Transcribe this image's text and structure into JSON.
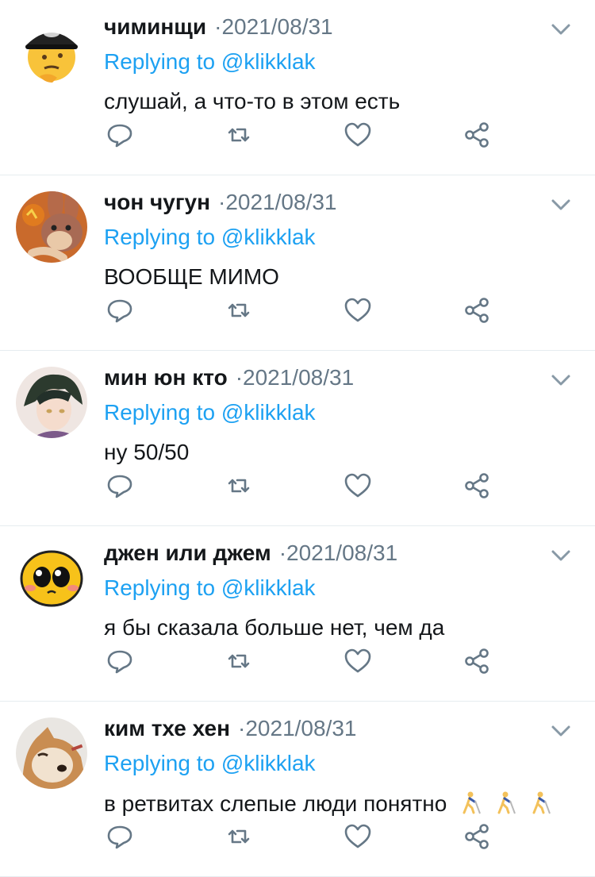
{
  "theme": {
    "text": "#14171a",
    "muted": "#657786",
    "link": "#1da1f2",
    "divider": "#e6ecf0",
    "icon": "#657786"
  },
  "tweets": [
    {
      "name": "чиминщи",
      "sep": "·",
      "date": "2021/08/31",
      "reply_prefix": "Replying to",
      "handle": "@klikklak",
      "text": "слушай, а что-то в этом есть",
      "avatar_icon": "thinking-face-cap-avatar"
    },
    {
      "name": "чон чугун",
      "sep": "·",
      "date": "2021/08/31",
      "reply_prefix": "Replying to",
      "handle": "@klikklak",
      "text": "ВООБЩЕ МИМО",
      "avatar_icon": "bunny-avatar"
    },
    {
      "name": "мин юн кто",
      "sep": "·",
      "date": "2021/08/31",
      "reply_prefix": "Replying to",
      "handle": "@klikklak",
      "text": "ну 50/50",
      "avatar_icon": "anime-character-avatar"
    },
    {
      "name": "джен или джем",
      "sep": "·",
      "date": "2021/08/31",
      "reply_prefix": "Replying to",
      "handle": "@klikklak",
      "text": "я бы сказала больше нет, чем да",
      "avatar_icon": "pleading-face-avatar"
    },
    {
      "name": "ким тхе хен",
      "sep": "·",
      "date": "2021/08/31",
      "reply_prefix": "Replying to",
      "handle": "@klikklak",
      "text": "в ретвитах слепые люди понятно",
      "trailing_emoji": [
        "person-with-white-cane-emoji",
        "person-with-white-cane-emoji",
        "person-with-white-cane-emoji"
      ],
      "avatar_icon": "shiba-dog-avatar"
    }
  ],
  "actions": [
    "reply-icon",
    "retweet-icon",
    "like-icon",
    "share-icon"
  ]
}
